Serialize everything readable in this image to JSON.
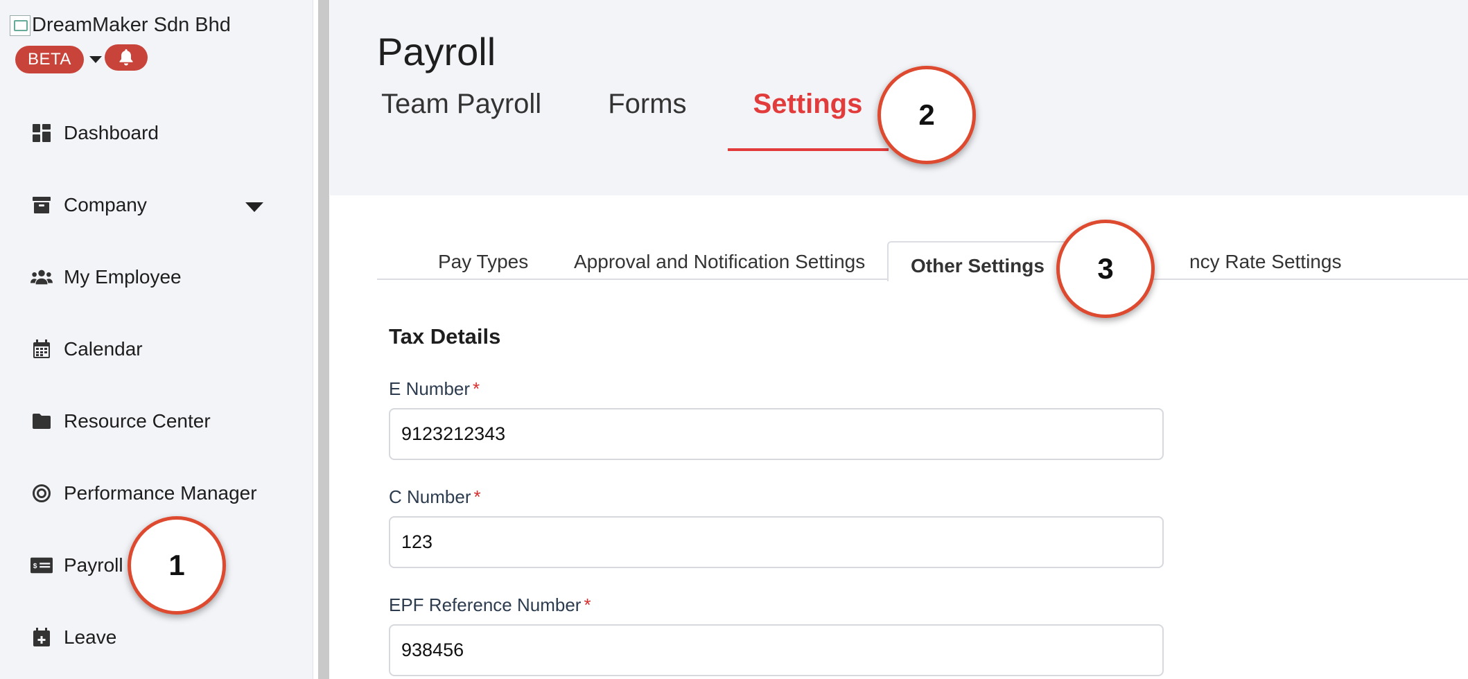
{
  "sidebar": {
    "logo_alt": "DreamMaker Sdn Bhd",
    "beta_label": "BETA",
    "items": [
      {
        "label": "Dashboard",
        "icon": "grid-icon"
      },
      {
        "label": "Company",
        "icon": "archive-icon"
      },
      {
        "label": "My Employee",
        "icon": "users-icon"
      },
      {
        "label": "Calendar",
        "icon": "calendar-icon"
      },
      {
        "label": "Resource Center",
        "icon": "folder-icon"
      },
      {
        "label": "Performance Manager",
        "icon": "target-icon"
      },
      {
        "label": "Payroll",
        "icon": "money-card-icon"
      },
      {
        "label": "Leave",
        "icon": "calendar-plus-icon"
      }
    ]
  },
  "header": {
    "title": "Payroll",
    "tabs": [
      {
        "label": "Team Payroll"
      },
      {
        "label": "Forms"
      },
      {
        "label": "Settings",
        "active": true
      }
    ]
  },
  "subtabs": [
    {
      "label": "Pay Types"
    },
    {
      "label": "Approval and Notification Settings"
    },
    {
      "label": "Other Settings",
      "active": true
    },
    {
      "label": "ncy Rate Settings"
    }
  ],
  "form": {
    "section_title": "Tax Details",
    "fields": [
      {
        "label": "E Number",
        "required_mark": "*",
        "value": "9123212343"
      },
      {
        "label": "C Number",
        "required_mark": "*",
        "value": "123"
      },
      {
        "label": "EPF Reference Number",
        "required_mark": "*",
        "value": "938456"
      }
    ]
  },
  "callouts": [
    "1",
    "2",
    "3"
  ],
  "colors": {
    "accent": "#e23b3b",
    "badge": "#c8433a",
    "callout_border": "#de4a2f",
    "sidebar_bg": "#f3f4f8"
  }
}
